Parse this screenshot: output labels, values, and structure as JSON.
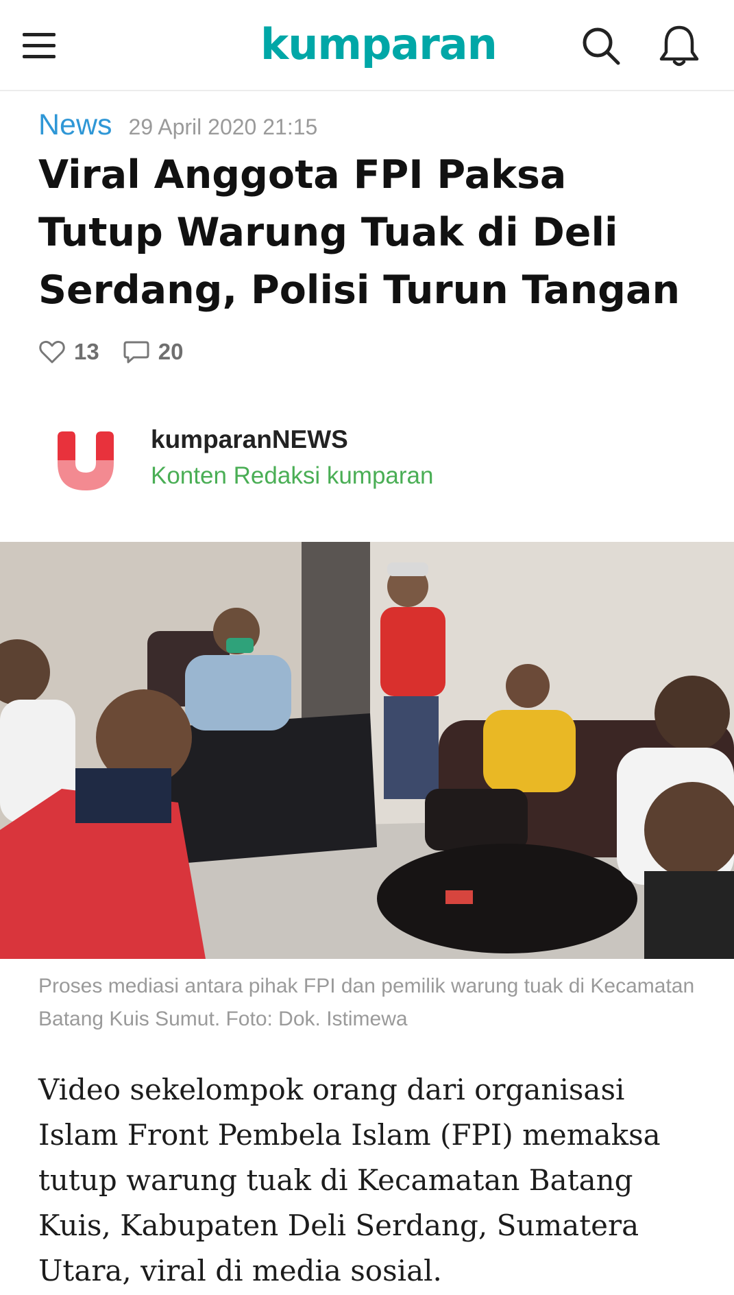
{
  "header": {
    "logo_text": "kumparan",
    "menu_icon": "hamburger-menu-icon",
    "search_icon": "search-icon",
    "notification_icon": "bell-icon",
    "logo_color": "#00a7a7"
  },
  "article": {
    "category": "News",
    "date": "29 April 2020 21:15",
    "title": "Viral Anggota FPI Paksa Tutup Warung Tuak di Deli Serdang, Polisi Turun Tangan",
    "likes": "13",
    "comments": "20",
    "author": {
      "name": "kumparanNEWS",
      "subtitle": "Konten Redaksi kumparan"
    },
    "image_caption": "Proses mediasi antara pihak FPI dan pemilik warung tuak di Kecamatan Batang Kuis Sumut. Foto: Dok. Istimewa",
    "body": "Video sekelompok orang dari organisasi Islam Front Pembela Islam (FPI) memaksa tutup warung tuak di Kecamatan Batang Kuis, Kabupaten Deli Serdang, Sumatera Utara, viral di media sosial."
  },
  "colors": {
    "category": "#2f97d6",
    "author_subtitle": "#4aae55",
    "brand_red": "#e8323c",
    "brand_pink": "#f38a91"
  }
}
